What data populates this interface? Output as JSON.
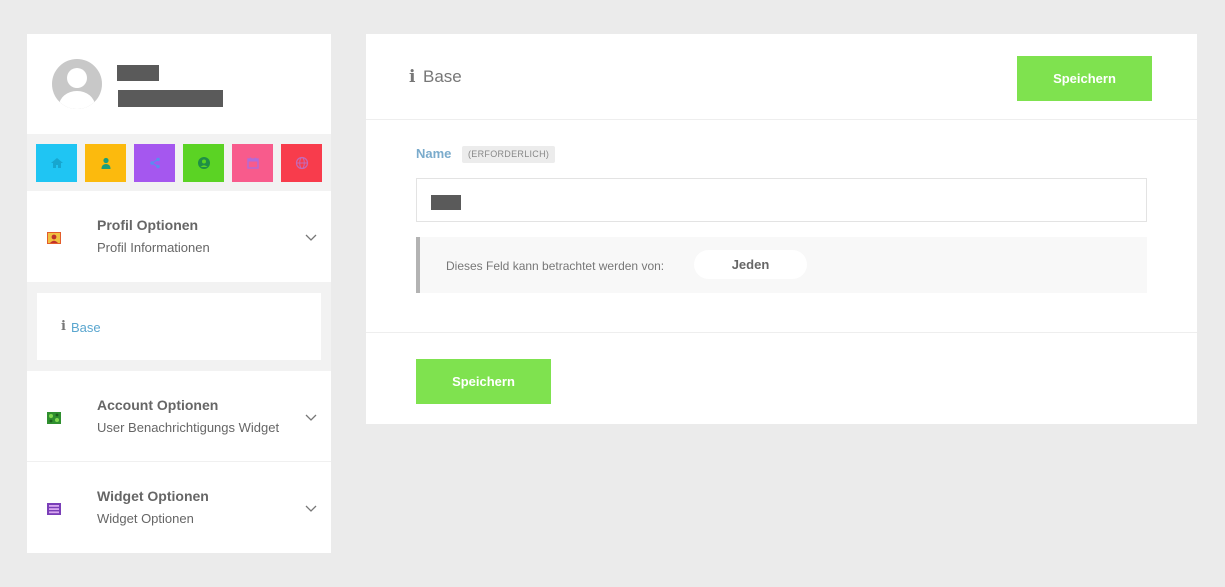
{
  "sidebar": {
    "icon_tiles": [
      {
        "name": "home-icon",
        "color": "#1fc5f3"
      },
      {
        "name": "user-icon",
        "color": "#fcba0d"
      },
      {
        "name": "share-icon",
        "color": "#a557ef"
      },
      {
        "name": "user-circle-icon",
        "color": "#5bd324"
      },
      {
        "name": "calendar-icon",
        "color": "#f85b8c"
      },
      {
        "name": "globe-icon",
        "color": "#f83c4c"
      }
    ],
    "sections": {
      "profile": {
        "title": "Profil Optionen",
        "subtitle": "Profil Informationen"
      },
      "account": {
        "title": "Account Optionen",
        "subtitle": "User Benachrichtigungs Widget"
      },
      "widget": {
        "title": "Widget Optionen",
        "subtitle": "Widget Optionen"
      }
    },
    "active_subitem": {
      "icon": "i",
      "label": "Base"
    }
  },
  "main": {
    "title_icon": "i",
    "title": "Base",
    "save_label": "Speichern",
    "field": {
      "label": "Name",
      "badge": "(ERFORDERLICH)"
    },
    "visibility": {
      "text": "Dieses Feld kann betrachtet werden von:",
      "value": "Jeden"
    },
    "footer_save_label": "Speichern"
  },
  "colors": {
    "accent_green": "#7fe24f",
    "link_blue": "#5aa6cf"
  }
}
